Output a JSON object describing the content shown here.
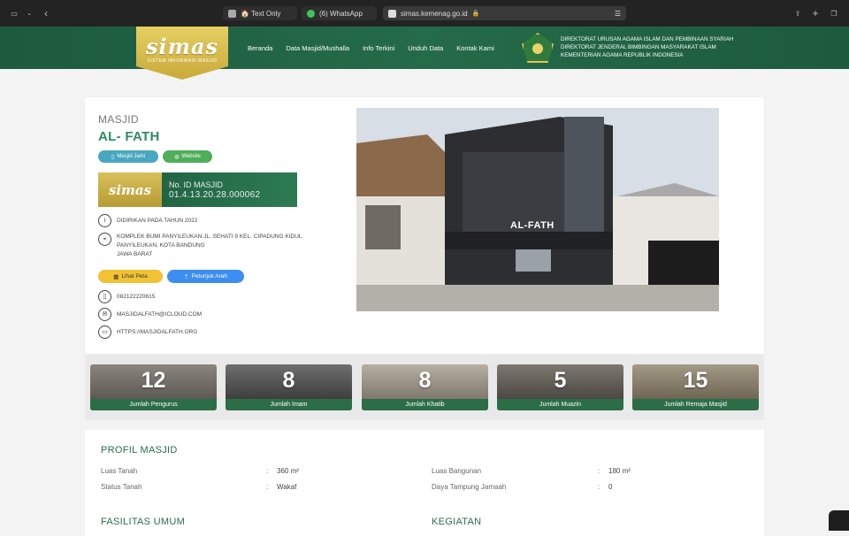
{
  "browser": {
    "tabs": [
      {
        "label": "🏠 Text Only"
      },
      {
        "label": "(6) WhatsApp"
      },
      {
        "label": "simas.kemenag.go.id"
      }
    ]
  },
  "header": {
    "logo_word": "simas",
    "logo_sub": "SISTEM INFORMASI MASJID",
    "nav": [
      "Beranda",
      "Data Masjid/Mushalla",
      "Info Terkini",
      "Unduh Data",
      "Kontak Kami"
    ],
    "ministry": [
      "DIREKTORAT URUSAN AGAMA ISLAM DAN PEMBINAAN SYARIAH",
      "DIREKTORAT JENDERAL BIMBINGAN MASYARAKAT ISLAM",
      "KEMENTERIAN AGAMA REPUBLIK INDONESIA"
    ]
  },
  "mosque": {
    "type_label": "MASJID",
    "name": "AL- FATH",
    "badges": {
      "type": "Masjid Jami",
      "web": "Website"
    },
    "id_label": "No. ID MASJID",
    "id_value": "01.4.13.20.28.000062",
    "founded": "DIDIRIKAN PADA TAHUN 2022",
    "address_1": "KOMPLEK BUMI PANYILEUKAN JL. SEHATI 9 KEL. CIPADUNG KIDUL",
    "address_2": "PANYILEUKAN, KOTA BANDUNG",
    "address_3": "JAWA BARAT",
    "btn_map": "Lihat Peta",
    "btn_directions": "Petunjuk Arah",
    "phone": "082122220615",
    "email": "MASJIDALFATH@ICLOUD.COM",
    "website": "HTTPS://MASJIDALFATH.ORG",
    "photo_sign": "AL-FATH"
  },
  "stats": [
    {
      "num": "12",
      "label": "Jumlah Pengurus"
    },
    {
      "num": "8",
      "label": "Jumlah Imam"
    },
    {
      "num": "8",
      "label": "Jumlah Khatib"
    },
    {
      "num": "5",
      "label": "Jumlah Muazin"
    },
    {
      "num": "15",
      "label": "Jumlah Remaja Masjid"
    }
  ],
  "profile": {
    "title": "PROFIL MASJID",
    "luas_tanah_label": "Luas Tanah",
    "luas_tanah": "360 m²",
    "status_tanah_label": "Status Tanah",
    "status_tanah": "Wakaf",
    "luas_bangunan_label": "Luas Bangunan",
    "luas_bangunan": "180 m²",
    "daya_label": "Daya Tampung Jamaah",
    "daya": "0",
    "colon": ":",
    "fasilitas": "FASILITAS UMUM",
    "kegiatan": "KEGIATAN"
  }
}
